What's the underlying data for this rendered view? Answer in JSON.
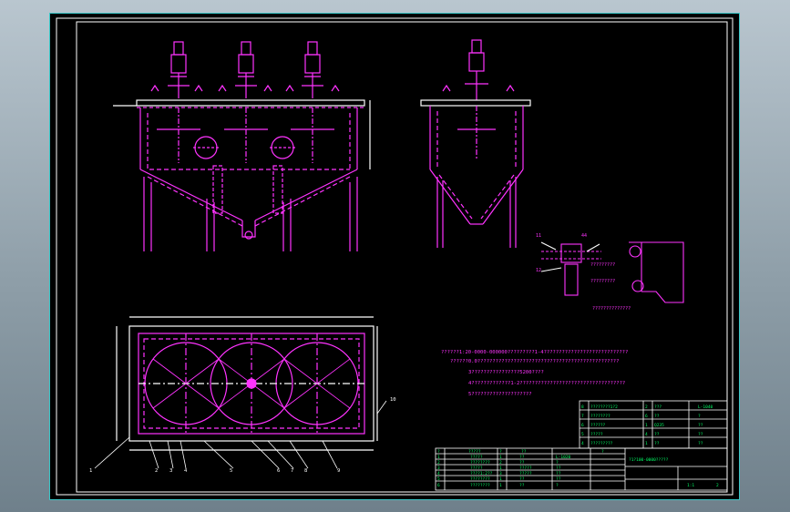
{
  "drawing": {
    "notes": [
      "??????1:20-0000-000000?????????1-4????????????????????????????",
      "??????0.0???????????????????????????????????????????????",
      "3????????????????5200????",
      "4?????????????1-2???????????????????????????????????",
      "5????????????????????"
    ],
    "detail_callouts": [
      "11",
      "44",
      "12"
    ],
    "detail_caption": "??????????????",
    "detail_labels": [
      "?????????",
      "?????????"
    ],
    "balloons_plan": [
      "1",
      "2",
      "3",
      "4",
      "5",
      "6",
      "7",
      "8",
      "9"
    ],
    "balloon_side": "10",
    "title_block": {
      "drawing_no": "?1?100-0000?????",
      "scale": "1:1",
      "sheet": "2",
      "header_cells": [
        "?",
        "?????",
        "?",
        "??",
        "?"
      ],
      "parts_rows": [
        [
          "1",
          "?????",
          "1",
          "??",
          "L-1020"
        ],
        [
          "2",
          "????????",
          "2",
          "??",
          "?"
        ],
        [
          "3",
          "?????",
          "1",
          "?????",
          "??"
        ],
        [
          "4",
          "????1:2??",
          "3",
          "?????",
          "??"
        ],
        [
          "5",
          "????????",
          "1",
          "??",
          "??"
        ],
        [
          "6",
          "????????",
          "1",
          "??",
          "?"
        ]
      ]
    },
    "parts_list_upper": [
      [
        "8",
        "????????1?2",
        "2",
        "???",
        "L-1040"
      ],
      [
        "7",
        "????????",
        "6",
        "??",
        "?"
      ],
      [
        "6",
        "??????",
        "1",
        "Q235",
        "??"
      ],
      [
        "5",
        "?????",
        "4",
        "??",
        "??"
      ],
      [
        "4",
        "?????????",
        "1",
        "??",
        "??"
      ]
    ]
  }
}
